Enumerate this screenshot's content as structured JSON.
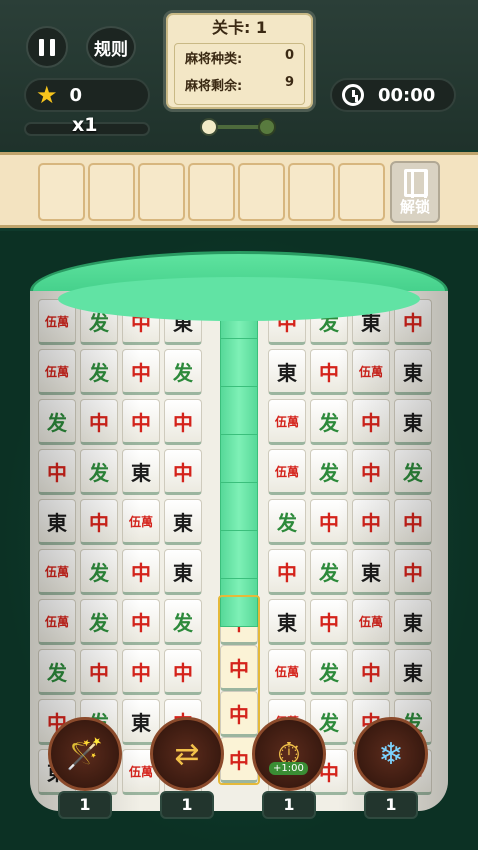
{
  "hud": {
    "rules_label": "规则",
    "stars": "0",
    "multiplier": "x1",
    "timer": "00:00",
    "level": {
      "title": "关卡: 1",
      "types_label": "麻将种类:",
      "types_value": "0",
      "remaining_label": "麻将剩余:",
      "remaining_value": "9"
    }
  },
  "slots": {
    "unlock_label": "解锁"
  },
  "tiles": [
    "伍萬",
    "发",
    "中",
    "東",
    "中",
    "发",
    "東",
    "中",
    "伍萬",
    "发",
    "中",
    "发",
    "東",
    "中",
    "伍萬",
    "東",
    "发",
    "中",
    "中",
    "中"
  ],
  "powerups": [
    {
      "name": "magic-wand-icon",
      "count": "1"
    },
    {
      "name": "shuffle-icon",
      "count": "1"
    },
    {
      "name": "clock-bonus-icon",
      "count": "1",
      "badge": "+1:00"
    },
    {
      "name": "freeze-icon",
      "count": "1"
    }
  ],
  "colors": {
    "accent_green": "#5ee39f",
    "panel": "#f3e7c6",
    "tile_red": "#d4231b",
    "tile_green": "#2d8a3b"
  }
}
